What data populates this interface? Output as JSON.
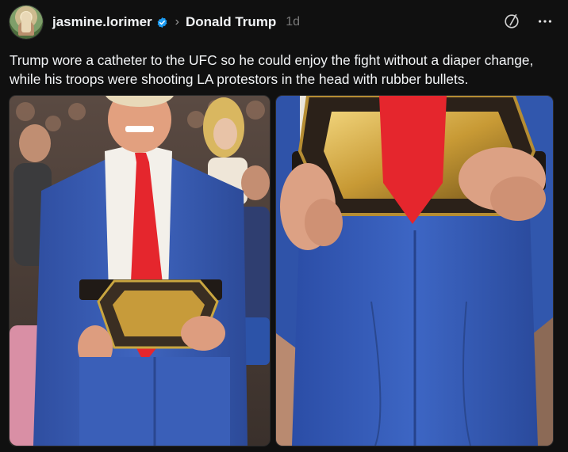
{
  "post": {
    "author": "jasmine.lorimer",
    "community": "Donald Trump",
    "time": "1d",
    "text": "Trump wore a catheter to the UFC so he could enjoy the fight without a diaper change,\nwhile his troops were shooting LA protestors in the head with rubber bullets."
  },
  "icons": {
    "verified": "verified-badge-icon",
    "chevron": "chevron-right-icon",
    "slash": "circle-slash-icon",
    "more": "more-horizontal-icon"
  },
  "colors": {
    "background": "#101010",
    "text": "#f3f5f7",
    "muted": "#7a7a7a",
    "verified": "#1d9bf0",
    "tie": "#e5262d",
    "suit": "#3a5fb8"
  }
}
